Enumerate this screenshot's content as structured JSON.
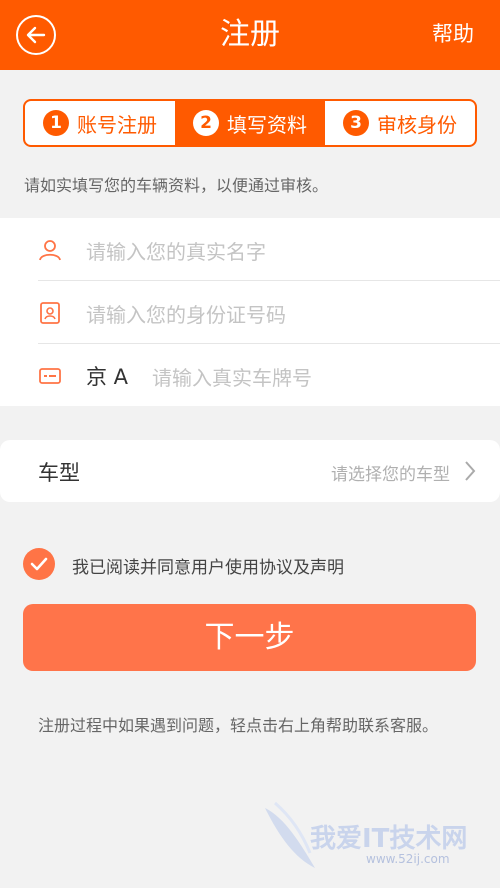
{
  "header": {
    "title": "注册",
    "help_label": "帮助"
  },
  "steps": [
    {
      "num": "1",
      "label": "账号注册",
      "active": false
    },
    {
      "num": "2",
      "label": "填写资料",
      "active": true
    },
    {
      "num": "3",
      "label": "审核身份",
      "active": false
    }
  ],
  "hint": "请如实填写您的车辆资料，以便通过审核。",
  "form": {
    "name_placeholder": "请输入您的真实名字",
    "id_placeholder": "请输入您的身份证号码",
    "plate_prefix": "京 A",
    "plate_placeholder": "请输入真实车牌号"
  },
  "model": {
    "label": "车型",
    "placeholder": "请选择您的车型"
  },
  "agree_text": "我已阅读并同意用户使用协议及声明",
  "next_button": "下一步",
  "footer_note": "注册过程中如果遇到问题，轻点击右上角帮助联系客服。",
  "watermark": {
    "text": "我爱IT技术网",
    "sub": "www.52ij.com"
  },
  "colors": {
    "brand": "#ff5a00",
    "button": "#ff744a"
  }
}
